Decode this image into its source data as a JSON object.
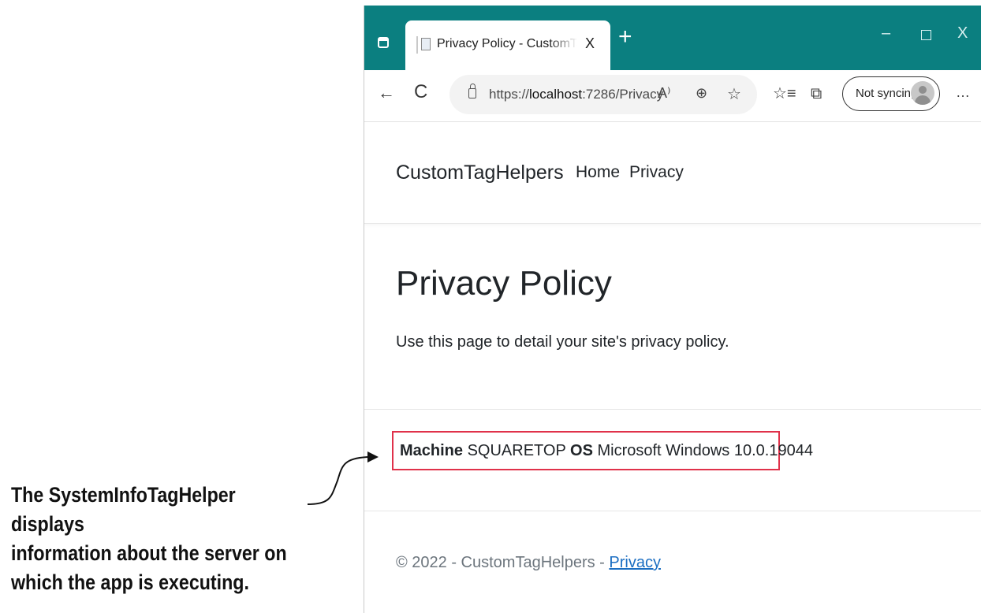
{
  "browser": {
    "tab": {
      "title": "Privacy Policy - CustomTagHelpers",
      "close_glyph": "X"
    },
    "new_tab_glyph": "+",
    "window_controls": {
      "minimize": "–",
      "close": "X"
    },
    "toolbar": {
      "back_glyph": "←",
      "refresh_glyph": "C",
      "url_prefix": "https://",
      "url_host": "localhost",
      "url_rest": ":7286/Privacy",
      "read_aloud_glyph": "A⁾",
      "zoom_glyph": "⊕",
      "favorite_add_glyph": "☆",
      "favorites_glyph": "☆≡",
      "collections_glyph": "⧉",
      "profile_label": "Not syncing",
      "more_glyph": "…"
    }
  },
  "site": {
    "brand": "CustomTagHelpers",
    "nav": {
      "home": "Home",
      "privacy": "Privacy"
    },
    "heading": "Privacy Policy",
    "description": "Use this page to detail your site's privacy policy.",
    "system_info": {
      "machine_label": "Machine",
      "machine_value": "SQUARETOP",
      "os_label": "OS",
      "os_value": "Microsoft Windows 10.0.19044"
    },
    "footer": {
      "text": "© 2022 - CustomTagHelpers - ",
      "link": "Privacy"
    }
  },
  "annotation": {
    "lines": [
      "The SystemInfoTagHelper displays",
      "information about the server on",
      "which the app is executing."
    ]
  },
  "colors": {
    "tab_strip": "#0b7f80",
    "highlight_border": "#e0314a",
    "footer_link": "#1b6ec2"
  }
}
